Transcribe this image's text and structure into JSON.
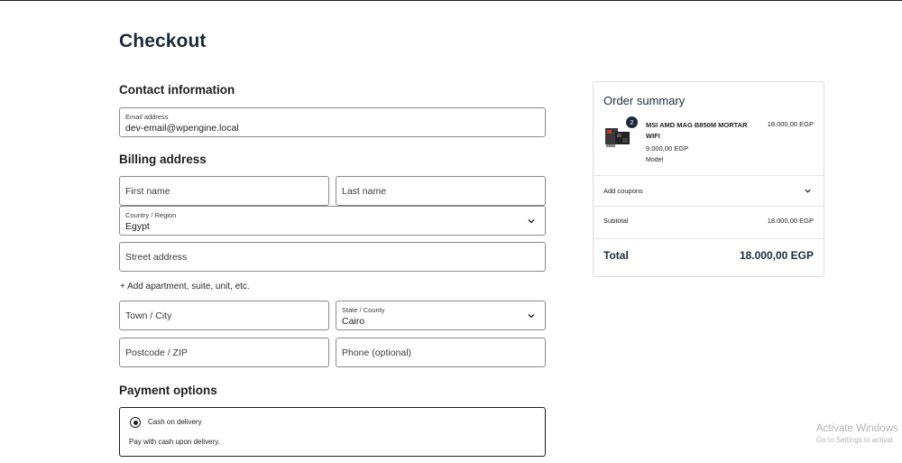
{
  "page": {
    "title": "Checkout"
  },
  "contact": {
    "section_title": "Contact information",
    "email_label": "Email address",
    "email_value": "dev-email@wpengine.local"
  },
  "billing": {
    "section_title": "Billing address",
    "first_name_placeholder": "First name",
    "last_name_placeholder": "Last name",
    "country_label": "Country / Region",
    "country_value": "Egypt",
    "street_placeholder": "Street address",
    "add_apartment": "+ Add apartment, suite, unit, etc.",
    "city_placeholder": "Town / City",
    "state_label": "State / County",
    "state_value": "Cairo",
    "postcode_placeholder": "Postcode / ZIP",
    "phone_placeholder": "Phone (optional)"
  },
  "payment": {
    "section_title": "Payment options",
    "option_label": "Cash on delivery",
    "option_description": "Pay with cash upon delivery.",
    "selected": true
  },
  "summary": {
    "title": "Order summary",
    "item": {
      "quantity": "2",
      "name": "MSI AMD MAG B850M MORTAR WIFI",
      "unit_price": "9.000,00 EGP",
      "line_total": "18.000,00 EGP",
      "meta": "Model"
    },
    "coupons_label": "Add coupons",
    "subtotal_label": "Subtotal",
    "subtotal_value": "18.000,00 EGP",
    "total_label": "Total",
    "total_value": "18.000,00 EGP"
  },
  "watermark": {
    "line1": "Activate Windows",
    "line2": "Go to Settings to activat"
  },
  "colors": {
    "text_dark": "#1e2a3a",
    "border": "#8a8a8a",
    "summary_border": "#dcdcdc"
  }
}
